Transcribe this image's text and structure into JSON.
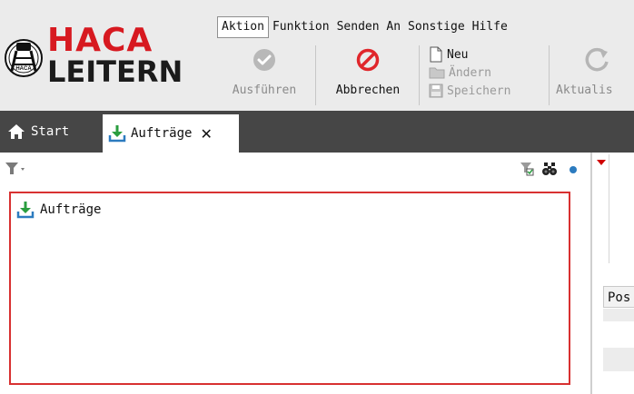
{
  "logo": {
    "line1": "HACA",
    "line2": "LEITERN",
    "badge": "HACA"
  },
  "menu": [
    "Aktion",
    "Funktion",
    "Senden An",
    "Sonstige",
    "Hilfe"
  ],
  "toolbar": {
    "execute": "Ausführen",
    "cancel": "Abbrechen",
    "new": "Neu",
    "edit": "Ändern",
    "save": "Speichern",
    "refresh": "Aktualis"
  },
  "tabs": {
    "start": "Start",
    "orders": "Aufträge",
    "close": "✕"
  },
  "tree": {
    "root": "Aufträge"
  },
  "right": {
    "column_header": "Pos"
  },
  "icons": [
    "home-icon",
    "download-icon",
    "filter-icon",
    "filter-check-icon",
    "binoculars-icon",
    "dot-icon",
    "check-icon",
    "prohibited-icon",
    "new-document-icon",
    "folder-icon",
    "save-icon",
    "refresh-icon"
  ],
  "colors": {
    "brand_red": "#d71920",
    "accent_green": "#2a9d3f",
    "accent_blue": "#2c7bbf",
    "selection_border": "#d83131",
    "tabbar": "#464646"
  }
}
